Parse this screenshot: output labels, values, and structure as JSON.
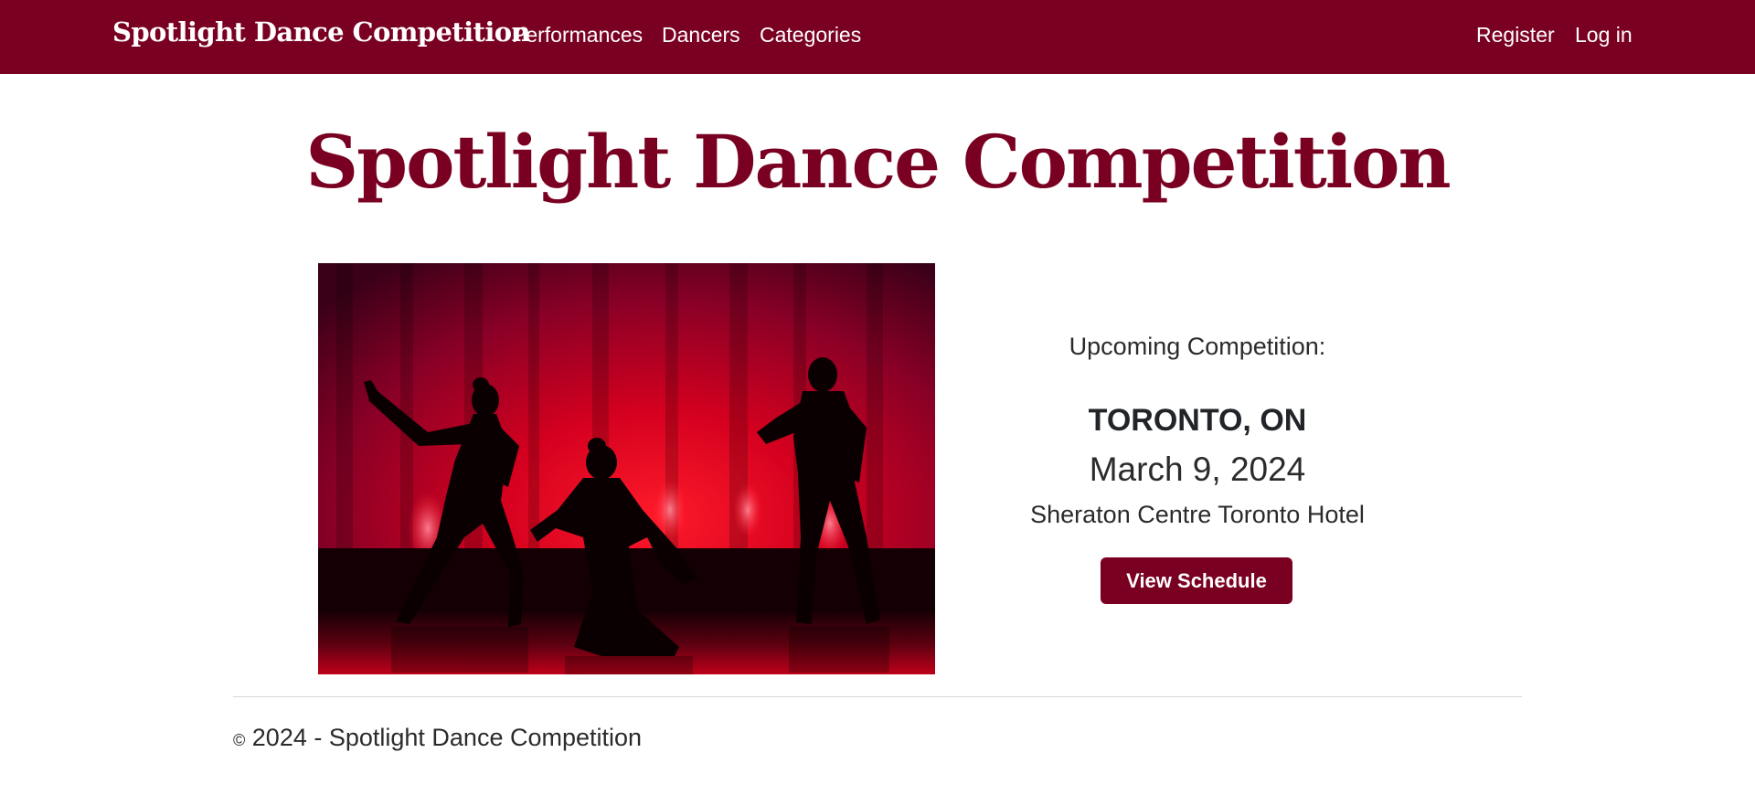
{
  "navbar": {
    "brand": "Spotlight Dance Competition",
    "links": [
      "Performances",
      "Dancers",
      "Categories"
    ],
    "right_links": [
      "Register",
      "Log in"
    ]
  },
  "hero": {
    "title": "Spotlight Dance Competition"
  },
  "competition": {
    "label": "Upcoming Competition:",
    "city": "TORONTO, ON",
    "date": "March 9, 2024",
    "venue": "Sheraton Centre Toronto Hotel",
    "button_label": "View Schedule"
  },
  "footer": {
    "copyright_symbol": "©",
    "text": "2024 - Spotlight Dance Competition"
  },
  "colors": {
    "brand": "#7a0022",
    "text": "#212529",
    "stage_red": "#e8001c"
  },
  "image": {
    "icon": "dancers-silhouette-photo"
  }
}
